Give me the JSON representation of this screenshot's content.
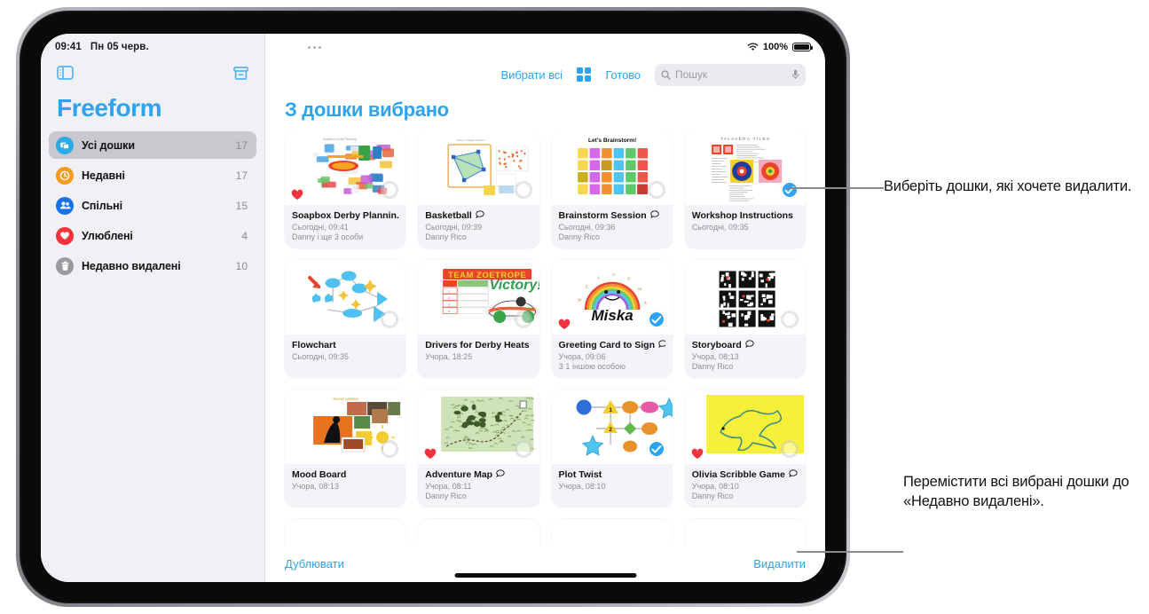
{
  "status_bar": {
    "time": "09:41",
    "date": "Пн 05 черв.",
    "battery_percent": "100%",
    "wifi_icon": "wifi-icon",
    "battery_icon": "battery-icon",
    "overflow_icon": "multitasking-dots-icon"
  },
  "sidebar": {
    "toggle_icon": "sidebar-toggle-icon",
    "new_board_icon": "new-board-icon",
    "app_title": "Freeform",
    "items": [
      {
        "label": "Усі дошки",
        "count": "17",
        "icon": "all-boards-icon",
        "color": "#2aaae7",
        "selected": true
      },
      {
        "label": "Недавні",
        "count": "17",
        "icon": "recents-clock-icon",
        "color": "#f79a1e",
        "selected": false
      },
      {
        "label": "Спільні",
        "count": "15",
        "icon": "shared-people-icon",
        "color": "#1a72e8",
        "selected": false
      },
      {
        "label": "Улюблені",
        "count": "4",
        "icon": "favorites-heart-icon",
        "color": "#f5323c",
        "selected": false
      },
      {
        "label": "Недавно видалені",
        "count": "10",
        "icon": "trash-icon",
        "color": "#9a9a9f",
        "selected": false
      }
    ]
  },
  "toolbar": {
    "select_all_label": "Вибрати всі",
    "grid_view_icon": "grid-view-icon",
    "done_label": "Готово",
    "search_placeholder": "Пошук",
    "search_icon": "search-icon",
    "mic_icon": "microphone-icon"
  },
  "main": {
    "page_title": "З дошки вибрано"
  },
  "boards": [
    {
      "name": "Soapbox Derby Plannin...",
      "date": "Сьогодні, 09:41",
      "owner": "Danny і ще 3 особи",
      "favorite": true,
      "selected": false,
      "shared": false,
      "art": "collage"
    },
    {
      "name": "Basketball",
      "date": "Сьогодні, 09:39",
      "owner": "Danny Rico",
      "favorite": false,
      "selected": false,
      "shared": true,
      "art": "court"
    },
    {
      "name": "Brainstorm Session",
      "date": "Сьогодні, 09:36",
      "owner": "Danny Rico",
      "favorite": false,
      "selected": false,
      "shared": true,
      "art": "stickies"
    },
    {
      "name": "Workshop Instructions",
      "date": "Сьогодні, 09:35",
      "owner": "",
      "favorite": false,
      "selected": true,
      "shared": false,
      "art": "tiles"
    },
    {
      "name": "Flowchart",
      "date": "Сьогодні, 09:35",
      "owner": "",
      "favorite": false,
      "selected": false,
      "shared": false,
      "art": "flow"
    },
    {
      "name": "Drivers for Derby Heats",
      "date": "Учора, 18:25",
      "owner": "",
      "favorite": false,
      "selected": false,
      "shared": false,
      "art": "derby"
    },
    {
      "name": "Greeting Card to Sign",
      "date": "Учора, 09:06",
      "owner": "З 1 іншою особою",
      "favorite": true,
      "selected": true,
      "shared": true,
      "art": "rainbow"
    },
    {
      "name": "Storyboard",
      "date": "Учора, 08:13",
      "owner": "Danny Rico",
      "favorite": false,
      "selected": false,
      "shared": true,
      "art": "storyboard"
    },
    {
      "name": "Mood Board",
      "date": "Учора, 08:13",
      "owner": "",
      "favorite": false,
      "selected": false,
      "shared": false,
      "art": "mood"
    },
    {
      "name": "Adventure Map",
      "date": "Учора, 08:11",
      "owner": "Danny Rico",
      "favorite": true,
      "selected": false,
      "shared": true,
      "art": "map"
    },
    {
      "name": "Plot Twist",
      "date": "Учора, 08:10",
      "owner": "",
      "favorite": false,
      "selected": true,
      "shared": false,
      "art": "plot"
    },
    {
      "name": "Olivia Scribble Game",
      "date": "Учора, 08:10",
      "owner": "Danny Rico",
      "favorite": true,
      "selected": false,
      "shared": true,
      "art": "scribble"
    }
  ],
  "bottom_bar": {
    "duplicate_label": "Дублювати",
    "delete_label": "Видалити"
  },
  "callouts": {
    "top": "Виберіть дошки, які хочете видалити.",
    "bottom": "Перемістити всі вибрані дошки до «Недавно видалені»."
  },
  "colors": {
    "accent_blue": "#2ea3ef",
    "sidebar_bg": "#f1f0f5",
    "card_bg": "#f4f3f7",
    "selected_row": "#c9c8ce",
    "heart_red": "#f5333f"
  }
}
